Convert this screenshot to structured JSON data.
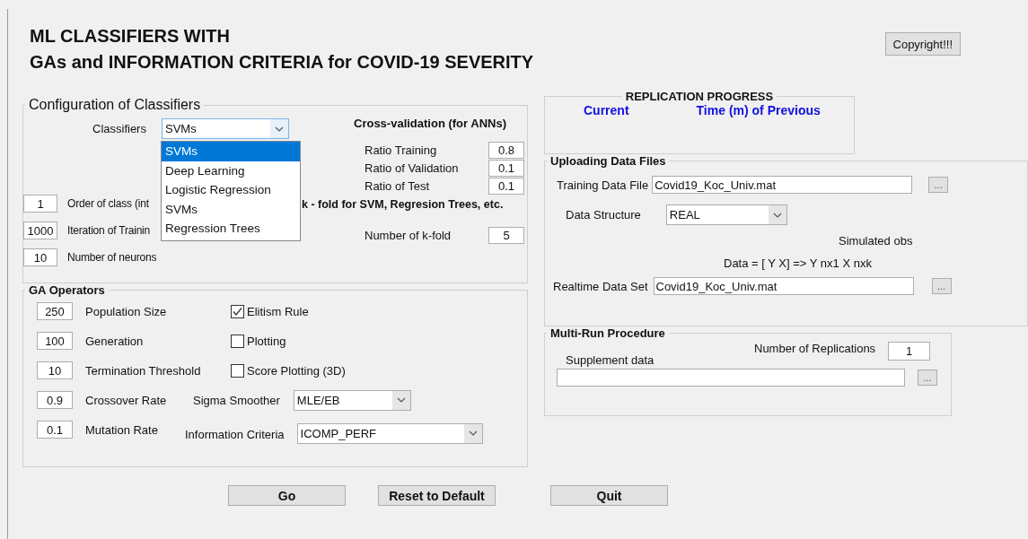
{
  "title_lines": [
    "ML CLASSIFIERS WITH",
    "GAs and INFORMATION CRITERIA for COVID-19 SEVERITY"
  ],
  "copyright_button": "Copyright!!!",
  "configuration": {
    "title": "Configuration of Classifiers",
    "classifier_label": "Classifiers",
    "classifier_value": "SVMs",
    "expanded": true,
    "options": [
      {
        "label": "SVMs",
        "selected": true
      },
      {
        "label": "Deep Learning",
        "selected": false
      },
      {
        "label": "Logistic Regression",
        "selected": false
      },
      {
        "label": "SVMs",
        "selected": false
      },
      {
        "label": "Regression Trees",
        "selected": false
      }
    ],
    "params": [
      {
        "value": "1",
        "label": "Order of class (int"
      },
      {
        "value": "1000",
        "label": "Iteration of Trainin"
      },
      {
        "value": "10",
        "label": "Number of neurons"
      }
    ],
    "cross_validation": {
      "title": "Cross-validation (for ANNs)",
      "ratios": [
        {
          "label": "Ratio Training",
          "value": "0.8"
        },
        {
          "label": "Ratio of Validation",
          "value": "0.1"
        },
        {
          "label": "Ratio of Test",
          "value": "0.1"
        }
      ]
    },
    "kfold": {
      "title": "k - fold for SVM, Regresion Trees, etc.",
      "label": "Number of k-fold",
      "value": "5"
    }
  },
  "ga": {
    "title": "GA Operators",
    "params": [
      {
        "value": "250",
        "label": "Population Size"
      },
      {
        "value": "100",
        "label": "Generation"
      },
      {
        "value": "10",
        "label": "Termination Threshold"
      },
      {
        "value": "0.9",
        "label": "Crossover Rate"
      },
      {
        "value": "0.1",
        "label": "Mutation Rate"
      }
    ],
    "options": [
      {
        "label": "Elitism Rule",
        "checked": true
      },
      {
        "label": "Plotting",
        "checked": false
      },
      {
        "label": "Score Plotting (3D)",
        "checked": false
      }
    ],
    "sigma": {
      "label": "Sigma Smoother",
      "value": "MLE/EB"
    },
    "criteria": {
      "label": "Information Criteria",
      "value": "ICOMP_PERF"
    }
  },
  "buttons": [
    "Go",
    "Reset to Default",
    "Quit"
  ],
  "replication": {
    "title": "REPLICATION PROGRESS",
    "columns": [
      "Current",
      "Time (m) of Previous"
    ]
  },
  "upload": {
    "title": "Uploading Data Files",
    "training": {
      "label": "Training Data File",
      "value": "Covid19_Koc_Univ.mat",
      "button": "..."
    },
    "structure": {
      "label": "Data Structure",
      "value": "REAL"
    },
    "note": "Simulated obs",
    "formula": "Data = [ Y X]  => Y nx1  X nxk",
    "realtime": {
      "label": "Realtime Data Set",
      "value": "Covid19_Koc_Univ.mat",
      "button": "..."
    }
  },
  "multirun": {
    "title": "Multi-Run Procedure",
    "supplement_label": "Supplement data",
    "replications_label": "Number of Replications",
    "replications_value": "1",
    "button": "..."
  }
}
